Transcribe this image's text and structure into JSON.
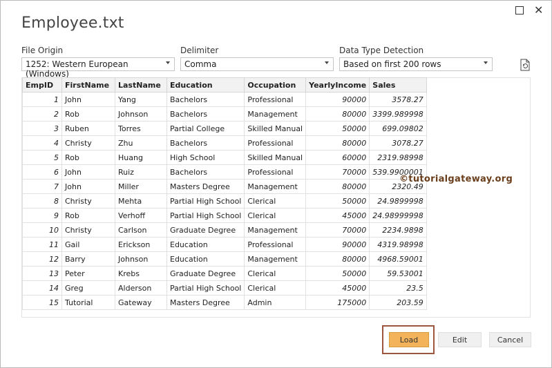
{
  "window": {
    "title": "Employee.txt"
  },
  "controls": {
    "file_origin": {
      "label": "File Origin",
      "value": "1252: Western European (Windows)"
    },
    "delimiter": {
      "label": "Delimiter",
      "value": "Comma"
    },
    "type_detection": {
      "label": "Data Type Detection",
      "value": "Based on first 200 rows"
    }
  },
  "table": {
    "columns": [
      "EmpID",
      "FirstName",
      "LastName",
      "Education",
      "Occupation",
      "YearlyIncome",
      "Sales"
    ],
    "rows": [
      [
        "1",
        "John",
        "Yang",
        "Bachelors",
        "Professional",
        "90000",
        "3578.27"
      ],
      [
        "2",
        "Rob",
        "Johnson",
        "Bachelors",
        "Management",
        "80000",
        "3399.989998"
      ],
      [
        "3",
        "Ruben",
        "Torres",
        "Partial College",
        "Skilled Manual",
        "50000",
        "699.09802"
      ],
      [
        "4",
        "Christy",
        "Zhu",
        "Bachelors",
        "Professional",
        "80000",
        "3078.27"
      ],
      [
        "5",
        "Rob",
        "Huang",
        "High School",
        "Skilled Manual",
        "60000",
        "2319.98998"
      ],
      [
        "6",
        "John",
        "Ruiz",
        "Bachelors",
        "Professional",
        "70000",
        "539.9900001"
      ],
      [
        "7",
        "John",
        "Miller",
        "Masters Degree",
        "Management",
        "80000",
        "2320.49"
      ],
      [
        "8",
        "Christy",
        "Mehta",
        "Partial High School",
        "Clerical",
        "50000",
        "24.9899998"
      ],
      [
        "9",
        "Rob",
        "Verhoff",
        "Partial High School",
        "Clerical",
        "45000",
        "24.98999998"
      ],
      [
        "10",
        "Christy",
        "Carlson",
        "Graduate Degree",
        "Management",
        "70000",
        "2234.9898"
      ],
      [
        "11",
        "Gail",
        "Erickson",
        "Education",
        "Professional",
        "90000",
        "4319.98998"
      ],
      [
        "12",
        "Barry",
        "Johnson",
        "Education",
        "Management",
        "80000",
        "4968.59001"
      ],
      [
        "13",
        "Peter",
        "Krebs",
        "Graduate Degree",
        "Clerical",
        "50000",
        "59.53001"
      ],
      [
        "14",
        "Greg",
        "Alderson",
        "Partial High School",
        "Clerical",
        "45000",
        "23.5"
      ],
      [
        "15",
        "Tutorial",
        "Gateway",
        "Masters Degree",
        "Admin",
        "175000",
        "203.59"
      ]
    ]
  },
  "watermark": "©tutorialgateway.org",
  "buttons": {
    "load": "Load",
    "edit": "Edit",
    "cancel": "Cancel"
  },
  "icons": {
    "maximize": "maximize-icon",
    "close": "close-icon",
    "refresh": "refresh-file-icon",
    "dropdown": "chevron-down-icon"
  }
}
